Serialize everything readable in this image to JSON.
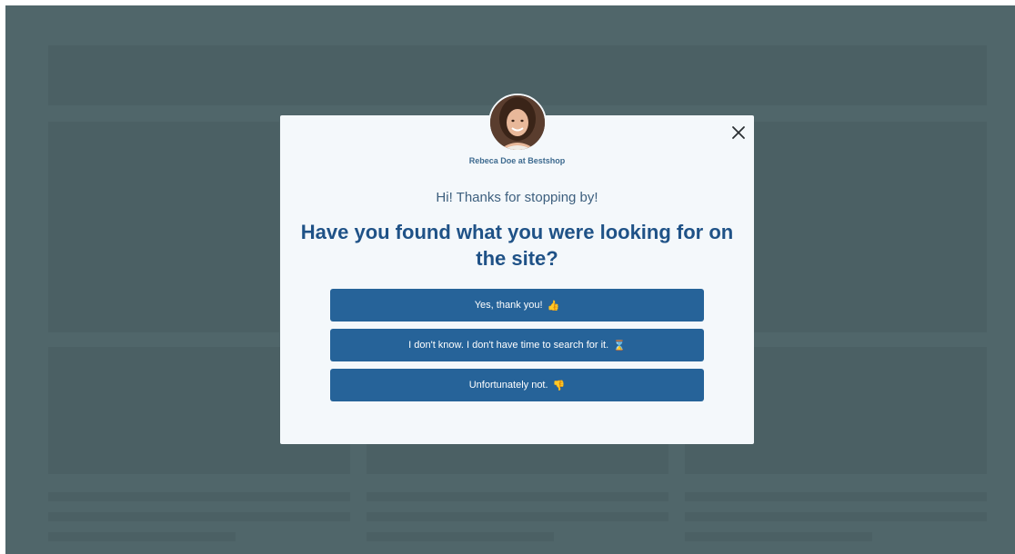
{
  "popup": {
    "agent_name": "Rebeca Doe at Bestshop",
    "greeting": "Hi! Thanks for stopping by!",
    "question": "Have you found what you were looking for on the site?",
    "answers": [
      {
        "label": "Yes, thank you!",
        "emoji": "👍"
      },
      {
        "label": "I don't know. I don't have time to search for it.",
        "emoji": "⌛"
      },
      {
        "label": "Unfortunately not.",
        "emoji": "👎"
      }
    ],
    "close_icon": "close-icon",
    "avatar_icon": "agent-avatar"
  },
  "colors": {
    "overlay": "#50666a",
    "modal_bg": "#f4f8fb",
    "button_bg": "#266399",
    "heading": "#1f5287"
  }
}
